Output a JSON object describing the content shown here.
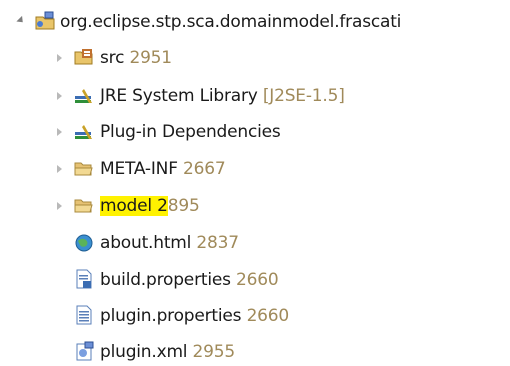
{
  "tree": {
    "root": {
      "label": "org.eclipse.stp.sca.domainmodel.frascati",
      "icon": "plugin-project-icon"
    },
    "items": [
      {
        "label": "src",
        "decoration": "2951",
        "icon": "source-folder-icon"
      },
      {
        "label": "JRE System Library",
        "decoration": "[J2SE-1.5]",
        "icon": "library-icon"
      },
      {
        "label": "Plug-in Dependencies",
        "decoration": "",
        "icon": "library-icon"
      },
      {
        "label": "META-INF",
        "decoration": "2667",
        "icon": "folder-icon"
      },
      {
        "label_highlighted": "model 2",
        "decoration_rest": "895",
        "icon": "folder-icon"
      },
      {
        "label": "about.html",
        "decoration": "2837",
        "icon": "html-file-icon"
      },
      {
        "label": "build.properties",
        "decoration": "2660",
        "icon": "properties-file-icon"
      },
      {
        "label": "plugin.properties",
        "decoration": "2660",
        "icon": "properties-file-icon"
      },
      {
        "label": "plugin.xml",
        "decoration": "2955",
        "icon": "plugin-xml-icon"
      }
    ]
  },
  "colors": {
    "decoration": "#a08a5a",
    "highlight": "#fff200",
    "text": "#1a1a1a"
  }
}
